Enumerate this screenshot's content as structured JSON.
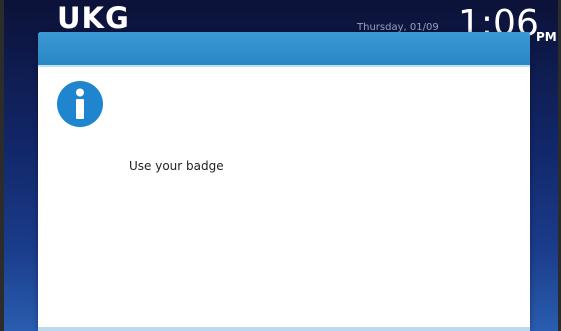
{
  "header": {
    "logo": "UKG",
    "date": "Thursday, 01/09",
    "time": "1:06",
    "ampm": "PM"
  },
  "dialog": {
    "icon": "info-icon",
    "message": "Use your badge"
  },
  "colors": {
    "header_blue": "#2a86c6",
    "icon_blue": "#1f85cf",
    "background_navy": "#12276a"
  }
}
